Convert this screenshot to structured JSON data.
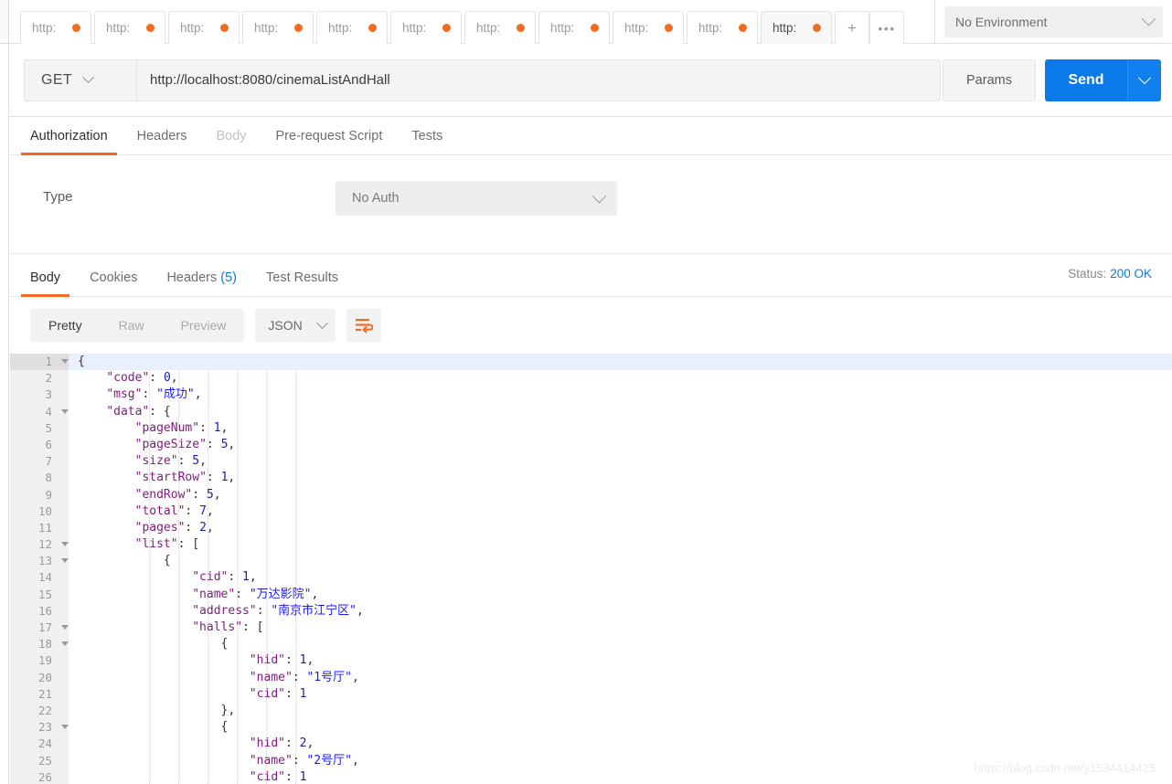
{
  "tabs": {
    "items": [
      {
        "label": "http:",
        "dirty": true,
        "active": false
      },
      {
        "label": "http:",
        "dirty": true,
        "active": false
      },
      {
        "label": "http:",
        "dirty": true,
        "active": false
      },
      {
        "label": "http:",
        "dirty": true,
        "active": false
      },
      {
        "label": "http:",
        "dirty": true,
        "active": false
      },
      {
        "label": "http:",
        "dirty": true,
        "active": false
      },
      {
        "label": "http:",
        "dirty": true,
        "active": false
      },
      {
        "label": "http:",
        "dirty": true,
        "active": false
      },
      {
        "label": "http:",
        "dirty": true,
        "active": false
      },
      {
        "label": "http:",
        "dirty": true,
        "active": false
      },
      {
        "label": "http:",
        "dirty": true,
        "active": true
      }
    ],
    "add_label": "+",
    "more_label": "•••"
  },
  "environment": {
    "selected": "No Environment",
    "chevron_icon": "chevron-down-icon"
  },
  "request": {
    "method": "GET",
    "url": "http://localhost:8080/cinemaListAndHall",
    "params_label": "Params",
    "send_label": "Send",
    "send_caret_icon": "chevron-down-icon",
    "tabs": [
      {
        "label": "Authorization",
        "state": "active"
      },
      {
        "label": "Headers",
        "state": "normal"
      },
      {
        "label": "Body",
        "state": "muted"
      },
      {
        "label": "Pre-request Script",
        "state": "normal"
      },
      {
        "label": "Tests",
        "state": "normal"
      }
    ]
  },
  "authorization": {
    "type_label": "Type",
    "type_value": "No Auth",
    "chevron_icon": "chevron-down-icon"
  },
  "response": {
    "tabs": [
      {
        "label": "Body",
        "state": "active",
        "count": ""
      },
      {
        "label": "Cookies",
        "state": "normal",
        "count": ""
      },
      {
        "label": "Headers",
        "state": "normal",
        "count": "(5)"
      },
      {
        "label": "Test Results",
        "state": "normal",
        "count": ""
      }
    ],
    "status_label": "Status:",
    "status_value": "200 OK",
    "view_modes": [
      {
        "label": "Pretty",
        "active": true
      },
      {
        "label": "Raw",
        "active": false
      },
      {
        "label": "Preview",
        "active": false
      }
    ],
    "format": "JSON",
    "format_chevron_icon": "chevron-down-icon",
    "wrap_icon": "word-wrap-icon"
  },
  "code": {
    "lines": [
      {
        "num": 1,
        "fold": true,
        "indent": 0,
        "tokens": [
          {
            "t": "{",
            "c": "p"
          }
        ]
      },
      {
        "num": 2,
        "fold": false,
        "indent": 1,
        "tokens": [
          {
            "t": "\"code\"",
            "c": "k"
          },
          {
            "t": ": ",
            "c": "p"
          },
          {
            "t": "0",
            "c": "n"
          },
          {
            "t": ",",
            "c": "p"
          }
        ]
      },
      {
        "num": 3,
        "fold": false,
        "indent": 1,
        "tokens": [
          {
            "t": "\"msg\"",
            "c": "k"
          },
          {
            "t": ": ",
            "c": "p"
          },
          {
            "t": "\"成功\"",
            "c": "s"
          },
          {
            "t": ",",
            "c": "p"
          }
        ]
      },
      {
        "num": 4,
        "fold": true,
        "indent": 1,
        "tokens": [
          {
            "t": "\"data\"",
            "c": "k"
          },
          {
            "t": ": {",
            "c": "p"
          }
        ]
      },
      {
        "num": 5,
        "fold": false,
        "indent": 2,
        "tokens": [
          {
            "t": "\"pageNum\"",
            "c": "k"
          },
          {
            "t": ": ",
            "c": "p"
          },
          {
            "t": "1",
            "c": "n"
          },
          {
            "t": ",",
            "c": "p"
          }
        ]
      },
      {
        "num": 6,
        "fold": false,
        "indent": 2,
        "tokens": [
          {
            "t": "\"pageSize\"",
            "c": "k"
          },
          {
            "t": ": ",
            "c": "p"
          },
          {
            "t": "5",
            "c": "n"
          },
          {
            "t": ",",
            "c": "p"
          }
        ]
      },
      {
        "num": 7,
        "fold": false,
        "indent": 2,
        "tokens": [
          {
            "t": "\"size\"",
            "c": "k"
          },
          {
            "t": ": ",
            "c": "p"
          },
          {
            "t": "5",
            "c": "n"
          },
          {
            "t": ",",
            "c": "p"
          }
        ]
      },
      {
        "num": 8,
        "fold": false,
        "indent": 2,
        "tokens": [
          {
            "t": "\"startRow\"",
            "c": "k"
          },
          {
            "t": ": ",
            "c": "p"
          },
          {
            "t": "1",
            "c": "n"
          },
          {
            "t": ",",
            "c": "p"
          }
        ]
      },
      {
        "num": 9,
        "fold": false,
        "indent": 2,
        "tokens": [
          {
            "t": "\"endRow\"",
            "c": "k"
          },
          {
            "t": ": ",
            "c": "p"
          },
          {
            "t": "5",
            "c": "n"
          },
          {
            "t": ",",
            "c": "p"
          }
        ]
      },
      {
        "num": 10,
        "fold": false,
        "indent": 2,
        "tokens": [
          {
            "t": "\"total\"",
            "c": "k"
          },
          {
            "t": ": ",
            "c": "p"
          },
          {
            "t": "7",
            "c": "n"
          },
          {
            "t": ",",
            "c": "p"
          }
        ]
      },
      {
        "num": 11,
        "fold": false,
        "indent": 2,
        "tokens": [
          {
            "t": "\"pages\"",
            "c": "k"
          },
          {
            "t": ": ",
            "c": "p"
          },
          {
            "t": "2",
            "c": "n"
          },
          {
            "t": ",",
            "c": "p"
          }
        ]
      },
      {
        "num": 12,
        "fold": true,
        "indent": 2,
        "tokens": [
          {
            "t": "\"list\"",
            "c": "k"
          },
          {
            "t": ": [",
            "c": "p"
          }
        ]
      },
      {
        "num": 13,
        "fold": true,
        "indent": 3,
        "tokens": [
          {
            "t": "{",
            "c": "p"
          }
        ]
      },
      {
        "num": 14,
        "fold": false,
        "indent": 4,
        "tokens": [
          {
            "t": "\"cid\"",
            "c": "k"
          },
          {
            "t": ": ",
            "c": "p"
          },
          {
            "t": "1",
            "c": "n"
          },
          {
            "t": ",",
            "c": "p"
          }
        ]
      },
      {
        "num": 15,
        "fold": false,
        "indent": 4,
        "tokens": [
          {
            "t": "\"name\"",
            "c": "k"
          },
          {
            "t": ": ",
            "c": "p"
          },
          {
            "t": "\"万达影院\"",
            "c": "s"
          },
          {
            "t": ",",
            "c": "p"
          }
        ]
      },
      {
        "num": 16,
        "fold": false,
        "indent": 4,
        "tokens": [
          {
            "t": "\"address\"",
            "c": "k"
          },
          {
            "t": ": ",
            "c": "p"
          },
          {
            "t": "\"南京市江宁区\"",
            "c": "s"
          },
          {
            "t": ",",
            "c": "p"
          }
        ]
      },
      {
        "num": 17,
        "fold": true,
        "indent": 4,
        "tokens": [
          {
            "t": "\"halls\"",
            "c": "k"
          },
          {
            "t": ": [",
            "c": "p"
          }
        ]
      },
      {
        "num": 18,
        "fold": true,
        "indent": 5,
        "tokens": [
          {
            "t": "{",
            "c": "p"
          }
        ]
      },
      {
        "num": 19,
        "fold": false,
        "indent": 6,
        "tokens": [
          {
            "t": "\"hid\"",
            "c": "k"
          },
          {
            "t": ": ",
            "c": "p"
          },
          {
            "t": "1",
            "c": "n"
          },
          {
            "t": ",",
            "c": "p"
          }
        ]
      },
      {
        "num": 20,
        "fold": false,
        "indent": 6,
        "tokens": [
          {
            "t": "\"name\"",
            "c": "k"
          },
          {
            "t": ": ",
            "c": "p"
          },
          {
            "t": "\"1号厅\"",
            "c": "s"
          },
          {
            "t": ",",
            "c": "p"
          }
        ]
      },
      {
        "num": 21,
        "fold": false,
        "indent": 6,
        "tokens": [
          {
            "t": "\"cid\"",
            "c": "k"
          },
          {
            "t": ": ",
            "c": "p"
          },
          {
            "t": "1",
            "c": "n"
          }
        ]
      },
      {
        "num": 22,
        "fold": false,
        "indent": 5,
        "tokens": [
          {
            "t": "},",
            "c": "p"
          }
        ]
      },
      {
        "num": 23,
        "fold": true,
        "indent": 5,
        "tokens": [
          {
            "t": "{",
            "c": "p"
          }
        ]
      },
      {
        "num": 24,
        "fold": false,
        "indent": 6,
        "tokens": [
          {
            "t": "\"hid\"",
            "c": "k"
          },
          {
            "t": ": ",
            "c": "p"
          },
          {
            "t": "2",
            "c": "n"
          },
          {
            "t": ",",
            "c": "p"
          }
        ]
      },
      {
        "num": 25,
        "fold": false,
        "indent": 6,
        "tokens": [
          {
            "t": "\"name\"",
            "c": "k"
          },
          {
            "t": ": ",
            "c": "p"
          },
          {
            "t": "\"2号厅\"",
            "c": "s"
          },
          {
            "t": ",",
            "c": "p"
          }
        ]
      },
      {
        "num": 26,
        "fold": false,
        "indent": 6,
        "tokens": [
          {
            "t": "\"cid\"",
            "c": "k"
          },
          {
            "t": ": ",
            "c": "p"
          },
          {
            "t": "1",
            "c": "n"
          }
        ]
      }
    ]
  },
  "watermark": "https://blog.csdn.net/y1534414425",
  "colors": {
    "accent_orange": "#f26b21",
    "send_blue": "#0c79e8",
    "link_blue": "#0d7de0",
    "json_key": "#7f1b7f",
    "json_string": "#1a1aff",
    "json_number": "#1a1ab0",
    "line_highlight": "#e8f0fe"
  }
}
